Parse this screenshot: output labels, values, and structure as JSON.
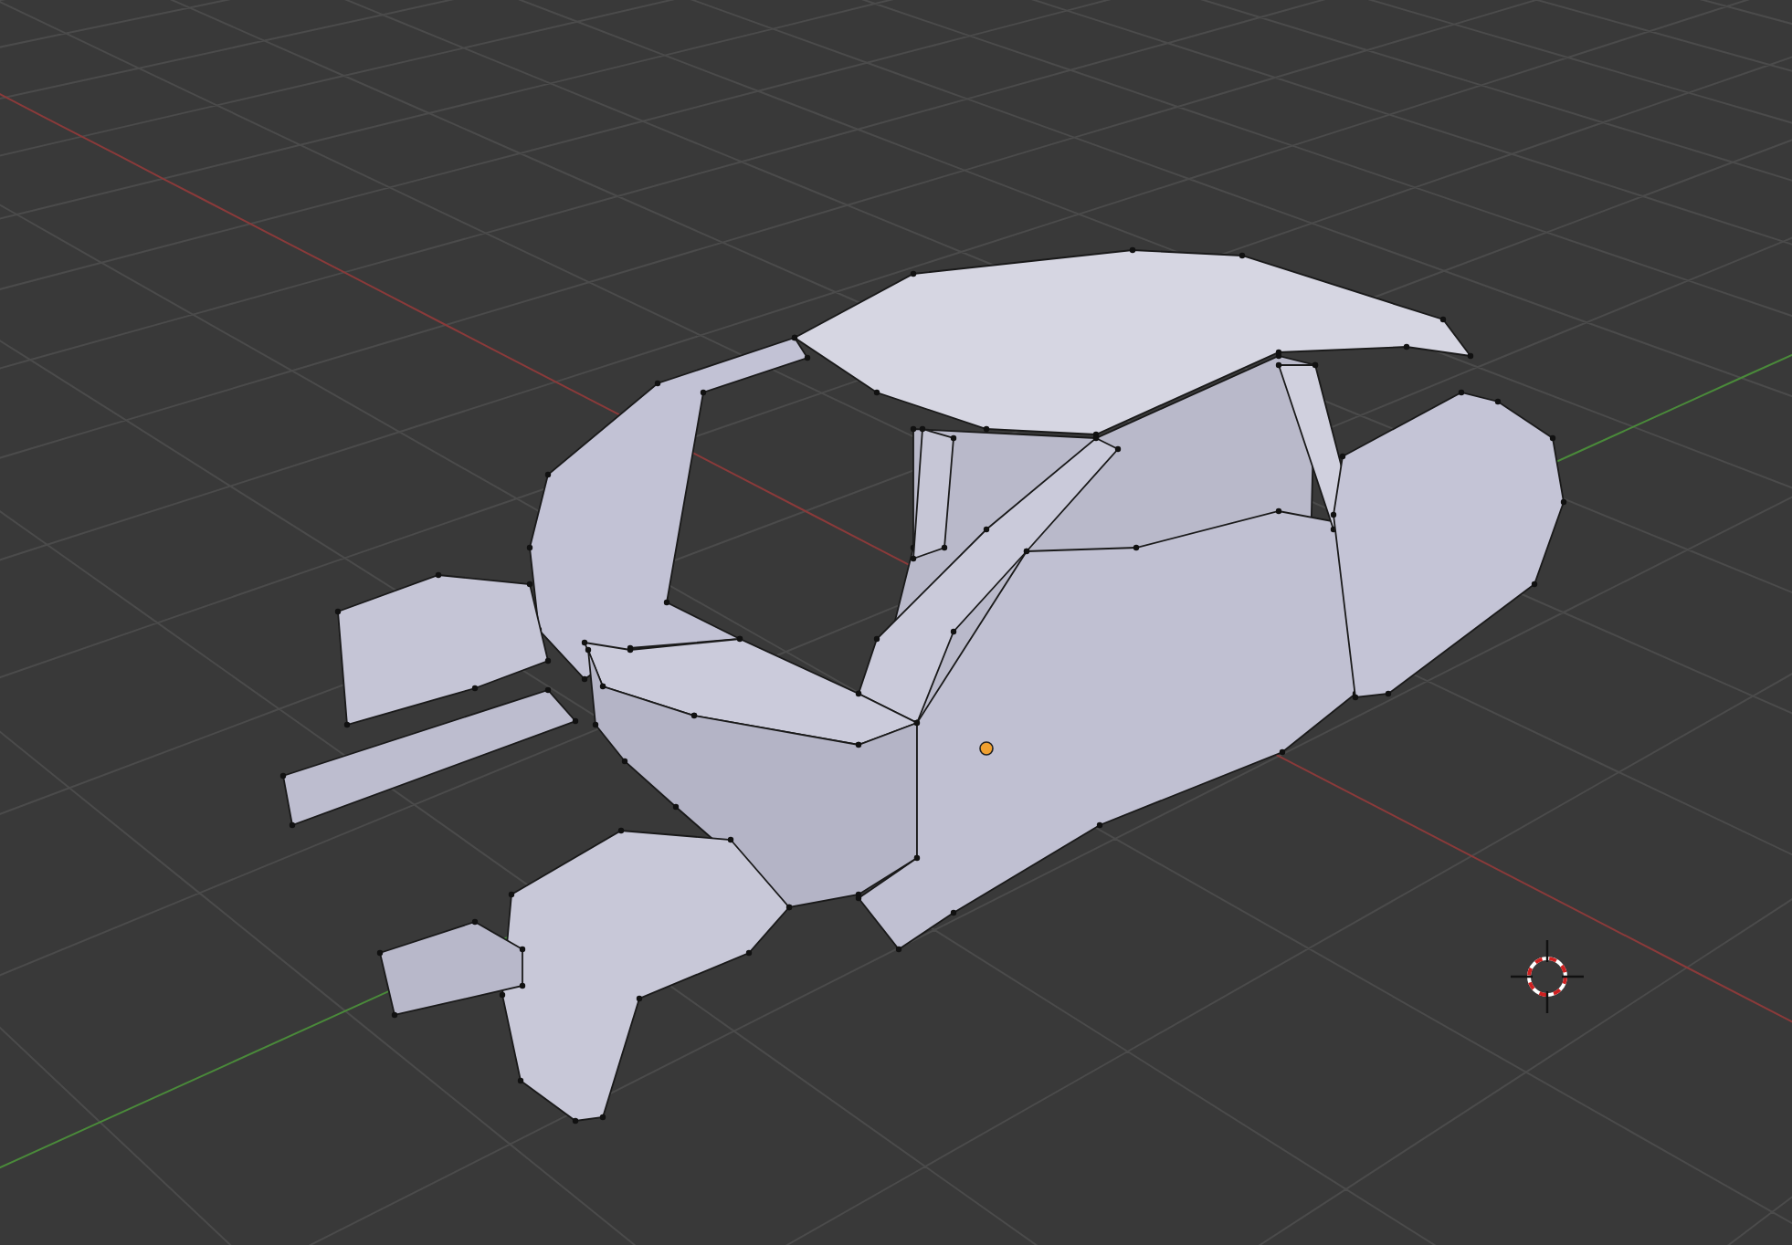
{
  "viewport": {
    "wireframe": true
  }
}
